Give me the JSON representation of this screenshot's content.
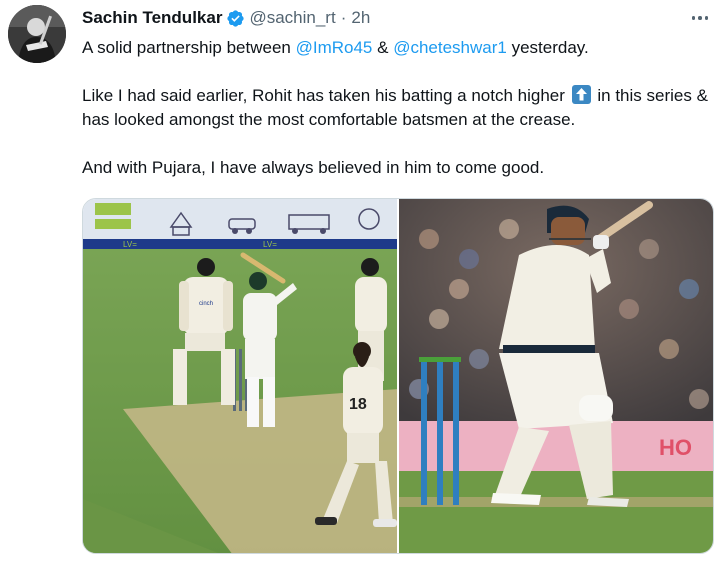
{
  "tweet": {
    "author": {
      "display_name": "Sachin Tendulkar",
      "handle": "@sachin_rt",
      "separator": "·",
      "time": "2h"
    },
    "text": {
      "p1_before": "A solid partnership between ",
      "mention1": "@ImRo45",
      "p1_mid": " & ",
      "mention2": "@cheteshwar1",
      "p1_after": " yesterday.",
      "p2_before": "Like I had said earlier, Rohit has taken his batting a notch higher ",
      "p2_after": " in this series & has looked amongst the most comfortable batsmen at the crease.",
      "p3": "And with Pujara, I have always believed in him to come good."
    },
    "media": {
      "left_photo": {
        "jersey_number": "18",
        "board_texts": [
          "cinch",
          "cinch",
          "LV=",
          "LV="
        ]
      },
      "right_photo": {
        "board_text": "HO"
      }
    }
  },
  "colors": {
    "text": "#0f1419",
    "secondary": "#536471",
    "link": "#1d9bf0",
    "verified": "#1d9bf0",
    "emoji_blue": "#3b88c3"
  },
  "icons": [
    "verified-badge-icon",
    "more-options-icon",
    "up-arrow-emoji-icon"
  ]
}
